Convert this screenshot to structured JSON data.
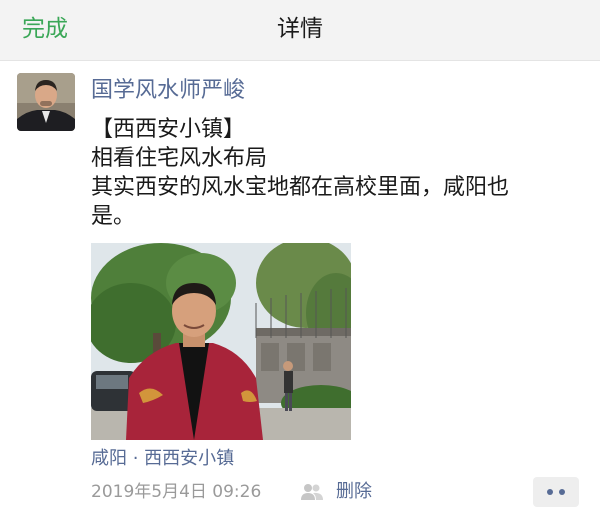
{
  "navbar": {
    "done_label": "完成",
    "title": "详情"
  },
  "post": {
    "author": "国学风水师严峻",
    "text_lines": [
      "【西西安小镇】",
      "相看住宅风水布局",
      "其实西安的风水宝地都在高校里面，咸阳也",
      "是。"
    ],
    "location": "咸阳 · 西西安小镇",
    "timestamp": "2019年5月4日 09:26",
    "delete_label": "删除",
    "more_icon": "more-dots-icon",
    "privacy_icon": "people-icon"
  },
  "colors": {
    "accent_green": "#3aa757",
    "link_blue": "#576b95",
    "meta_gray": "#9a9a9a"
  }
}
